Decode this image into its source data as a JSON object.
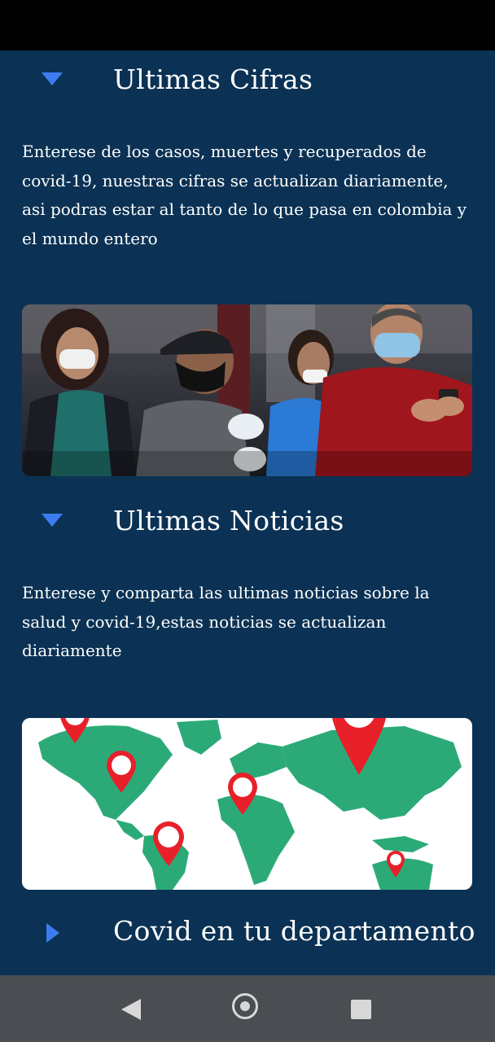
{
  "sections": [
    {
      "title": "Ultimas Cifras",
      "description": "Enterese de los casos, muertes y recuperados de covid-19, nuestras cifras se actualizan diariamente, asi podras estar al tanto de lo que pasa en colombia y el mundo entero",
      "expanded": true,
      "image": "people-wearing-masks-photo"
    },
    {
      "title": "Ultimas Noticias",
      "description": "Enterese y comparta las ultimas noticias sobre la salud y covid-19,estas noticias se actualizan diariamente",
      "expanded": true,
      "image": "world-map-with-location-pins"
    },
    {
      "title": "Covid en tu departamento",
      "expanded": false
    }
  ],
  "colors": {
    "background": "#0b3254",
    "accent_arrow": "#3d7cf0",
    "map_land": "#2baa78",
    "map_pin": "#e8202a"
  },
  "navigation": {
    "icons": [
      "back-icon",
      "home-icon",
      "recents-icon"
    ]
  }
}
